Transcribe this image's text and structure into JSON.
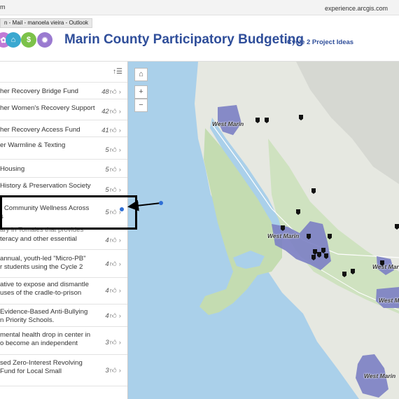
{
  "browser": {
    "tab_text": "m",
    "url": "experience.arcgis.com",
    "tooltip": "n - Mail - manoela vieira - Outlook"
  },
  "header": {
    "title": "Marin County Participatory Budgeting",
    "subtitle": "Cycle 2 Project Ideas",
    "title_color": "#2f4e9a",
    "logo_icons": [
      "people-icon",
      "home-icon",
      "money-icon",
      "gear-icon"
    ]
  },
  "list": {
    "sort_icon": "sort-icon",
    "items": [
      {
        "text": "her Recovery Bridge Fund",
        "count": "48"
      },
      {
        "text": "her Women's Recovery Support",
        "count": "42"
      },
      {
        "text": "her Recovery Access Fund",
        "count": "41"
      },
      {
        "text": "er Warmline & Texting",
        "count": "5"
      },
      {
        "text": "Housing",
        "count": "5"
      },
      {
        "text": "History & Preservation Society",
        "count": "5"
      },
      {
        "text": "r Community Wellness Across",
        "text2": "s",
        "count": "5"
      },
      {
        "text": "ary in Tomales that provides",
        "text2": "teracy and other essential",
        "count": "4"
      },
      {
        "text": "annual, youth-led \"Micro-PB\"",
        "text2": "r students using the Cycle 2",
        "count": "4"
      },
      {
        "text": "ative to expose and dismantle",
        "text2": "uses of the cradle-to-prison",
        "count": "4"
      },
      {
        "text": "Evidence-Based Anti-Bullying",
        "text2": "n Priority Schools.",
        "count": "4"
      },
      {
        "text": "mental health drop in center in",
        "text2": "o become an independent",
        "count": "3"
      },
      {
        "text": "sed Zero-Interest Revolving",
        "text2": "Fund for Local Small",
        "count": "3"
      }
    ]
  },
  "map": {
    "buttons": {
      "home": "⌂",
      "zoom_in": "+",
      "zoom_out": "−"
    },
    "labels": [
      "West Marin",
      "West Marin",
      "West Marin",
      "West Marin",
      "West Marin"
    ],
    "colors": {
      "water": "#aad0ea",
      "land": "#e9ece4",
      "green": "#c8dfb8",
      "district": "#7b80c4"
    }
  }
}
